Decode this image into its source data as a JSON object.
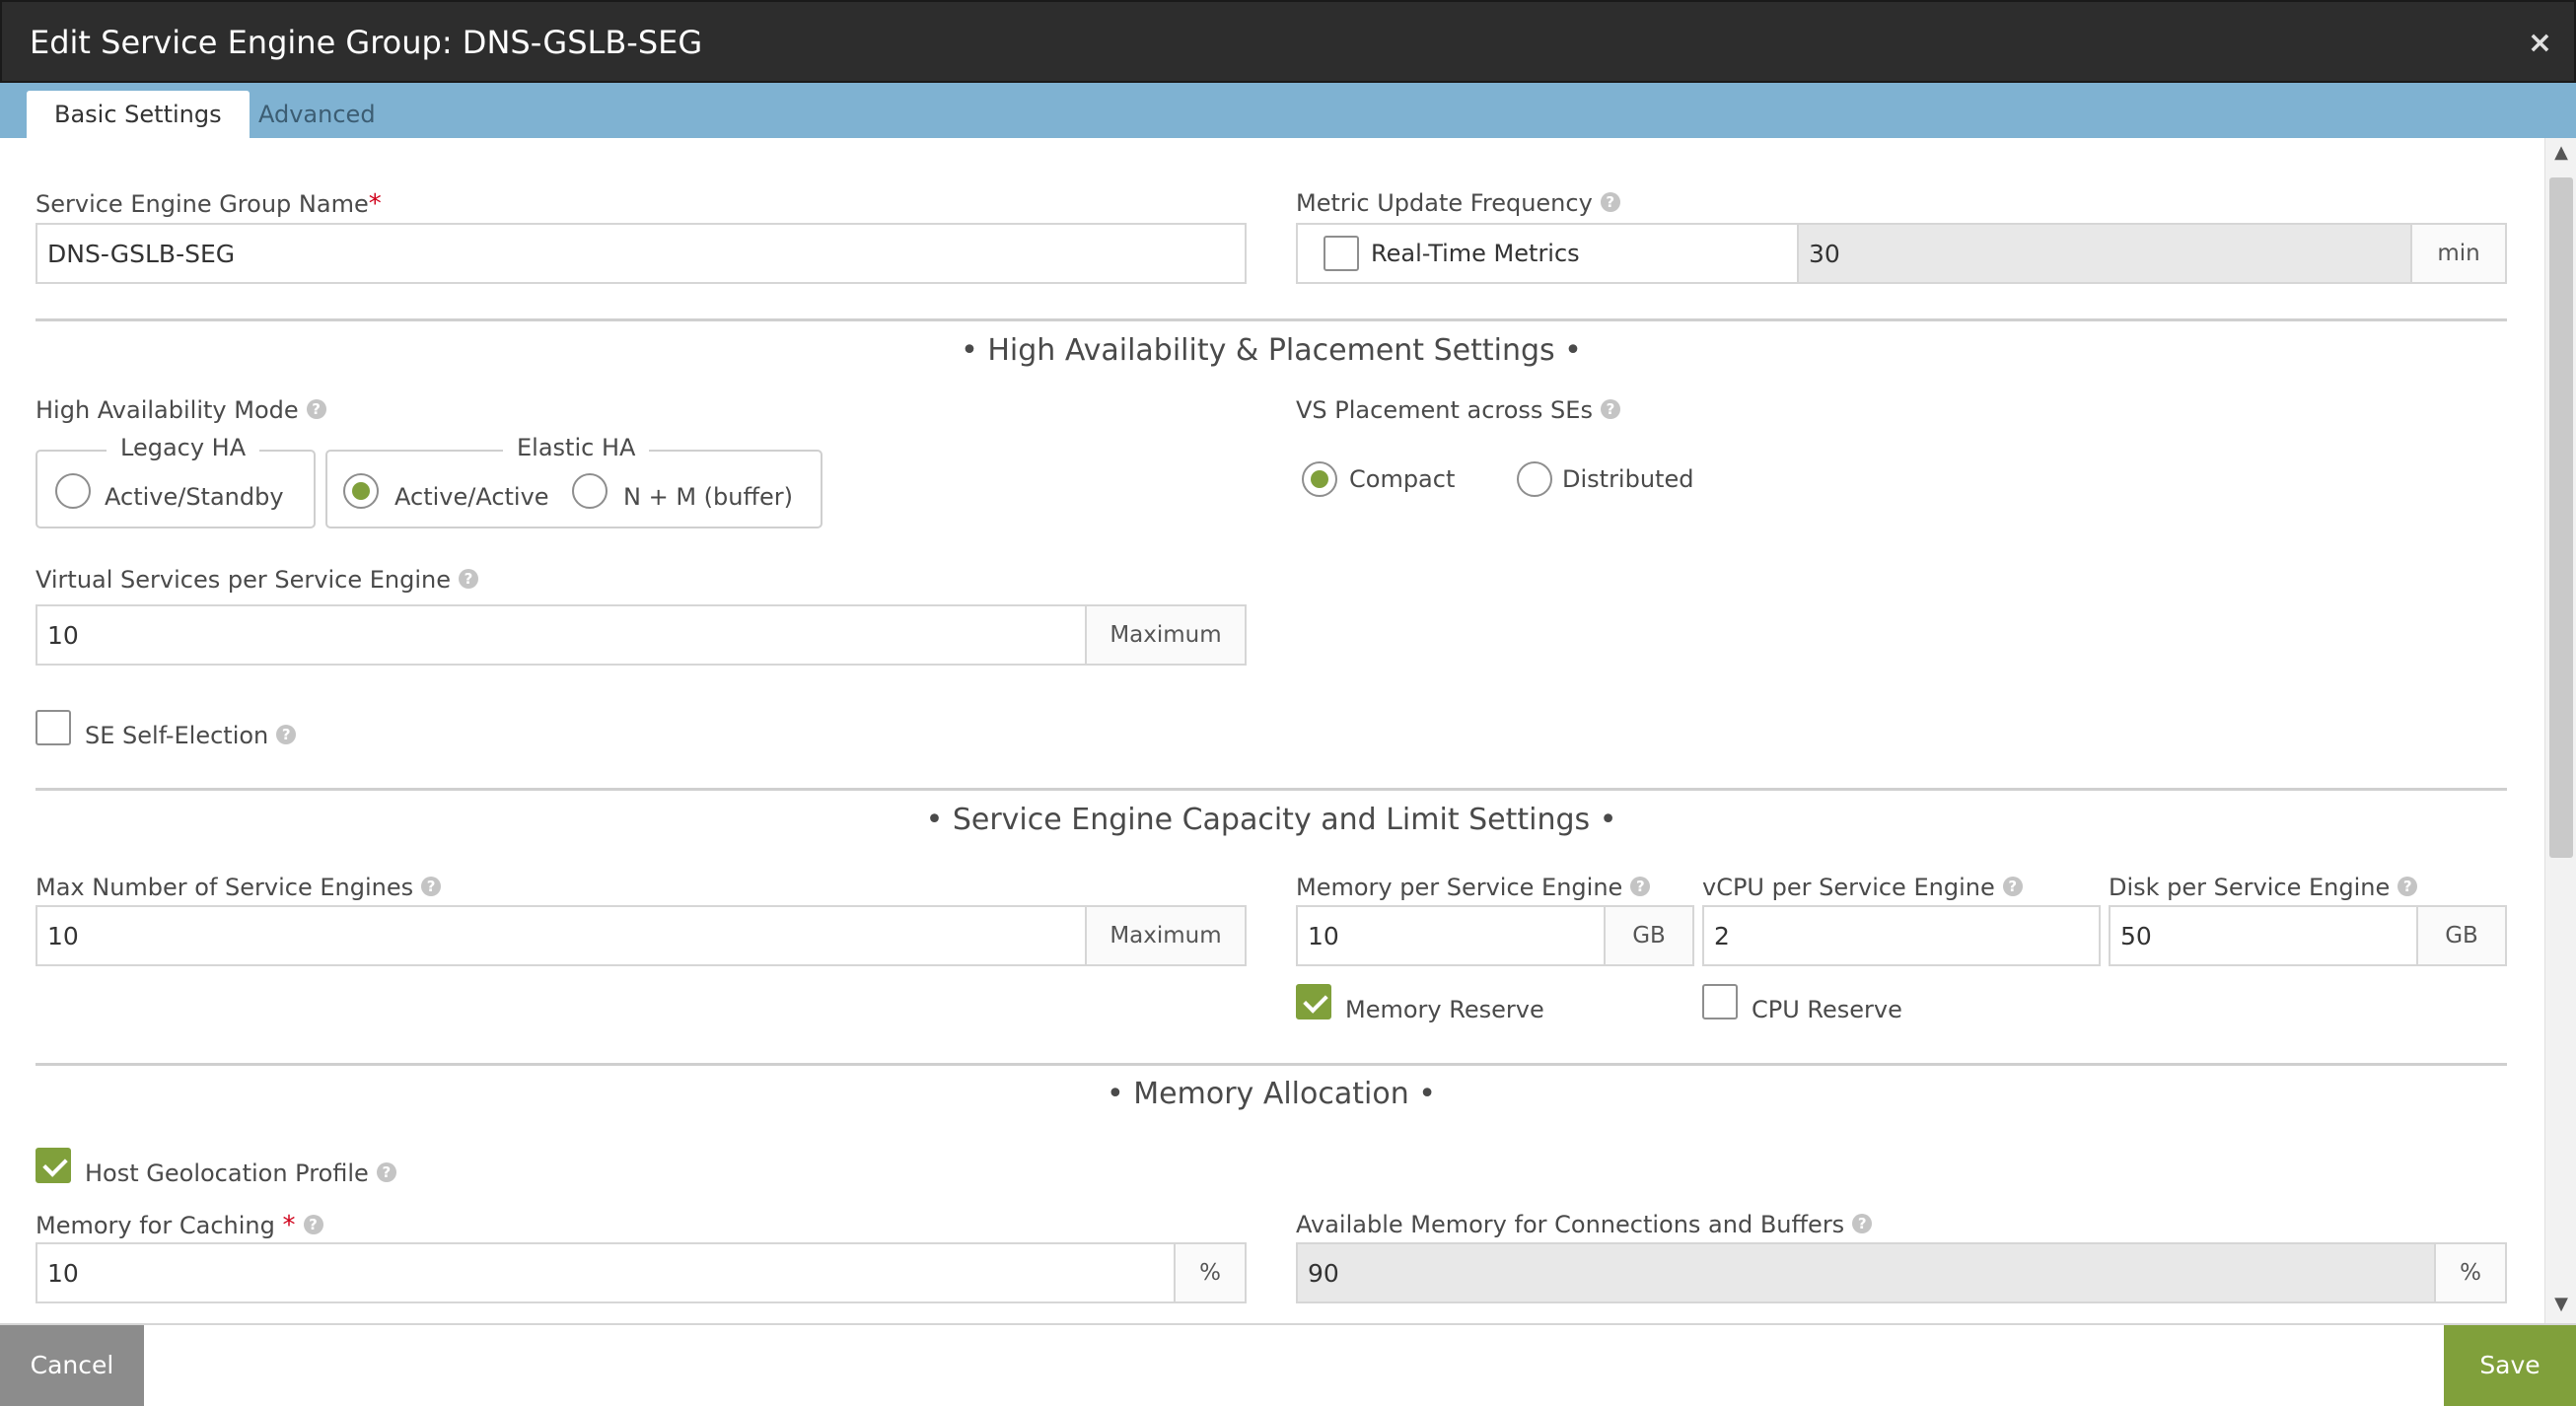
{
  "header": {
    "title": "Edit Service Engine Group: DNS-GSLB-SEG",
    "close_icon": "×"
  },
  "tabs": [
    {
      "label": "Basic Settings",
      "active": true
    },
    {
      "label": "Advanced",
      "active": false
    }
  ],
  "se_group_name": {
    "label": "Service Engine Group Name",
    "required_mark": "*",
    "value": "DNS-GSLB-SEG"
  },
  "metric_update": {
    "label": "Metric Update Frequency",
    "checkbox_label": "Real-Time Metrics",
    "checked": false,
    "value": "30",
    "unit": "min"
  },
  "section_ha": {
    "title": "• High Availability & Placement Settings •"
  },
  "ha_mode": {
    "label": "High Availability Mode",
    "legacy_legend": "Legacy HA",
    "elastic_legend": "Elastic HA",
    "options": [
      {
        "label": "Active/Standby",
        "selected": false
      },
      {
        "label": "Active/Active",
        "selected": true
      },
      {
        "label": "N + M (buffer)",
        "selected": false
      }
    ]
  },
  "vs_placement": {
    "label": "VS Placement across SEs",
    "options": [
      {
        "label": "Compact",
        "selected": true
      },
      {
        "label": "Distributed",
        "selected": false
      }
    ]
  },
  "vs_per_se": {
    "label": "Virtual Services per Service Engine",
    "value": "10",
    "addon": "Maximum"
  },
  "se_self_election": {
    "label": "SE Self-Election",
    "checked": false
  },
  "section_capacity": {
    "title": "•  Service Engine Capacity and Limit Settings  •"
  },
  "max_se": {
    "label": "Max Number of Service Engines",
    "value": "10",
    "addon": "Maximum"
  },
  "memory_per_se": {
    "label": "Memory per Service Engine",
    "value": "10",
    "unit": "GB"
  },
  "vcpu_per_se": {
    "label": "vCPU per Service Engine",
    "value": "2"
  },
  "disk_per_se": {
    "label": "Disk per Service Engine",
    "value": "50",
    "unit": "GB"
  },
  "memory_reserve": {
    "label": "Memory Reserve",
    "checked": true
  },
  "cpu_reserve": {
    "label": "CPU Reserve",
    "checked": false
  },
  "section_memory": {
    "title": "• Memory Allocation •"
  },
  "host_geo": {
    "label": "Host Geolocation Profile",
    "checked": true
  },
  "memory_caching": {
    "label": "Memory for Caching",
    "required_mark": "*",
    "value": "10",
    "unit": "%"
  },
  "avail_memory": {
    "label": "Available Memory for Connections and Buffers",
    "value": "90",
    "unit": "%"
  },
  "footer": {
    "cancel": "Cancel",
    "save": "Save"
  },
  "help_glyph": "?",
  "colors": {
    "accent": "#80a03b",
    "tabbar": "#7fb2d2",
    "header": "#2d2d2d",
    "required": "#d0021b"
  }
}
